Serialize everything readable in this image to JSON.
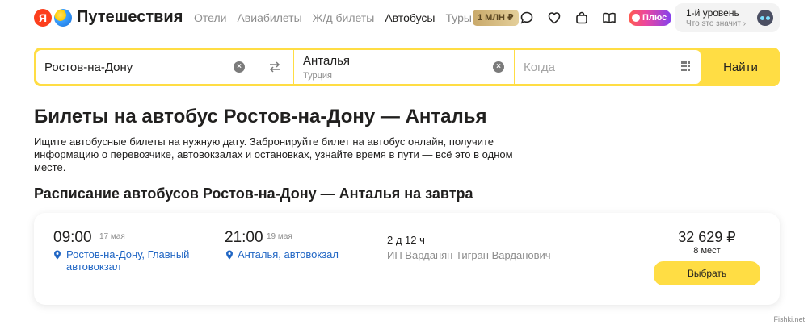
{
  "header": {
    "logo_letter": "Я",
    "logo_text": "Путешествия",
    "nav": [
      {
        "label": "Отели",
        "active": false
      },
      {
        "label": "Авиабилеты",
        "active": false
      },
      {
        "label": "Ж/д билеты",
        "active": false
      },
      {
        "label": "Автобусы",
        "active": true
      },
      {
        "label": "Туры",
        "active": false
      }
    ],
    "badge": "1 МЛН ₽",
    "plus_label": "Плюс",
    "level_title": "1-й уровень",
    "level_sub": "Что это значит",
    "level_arrow": "›"
  },
  "search": {
    "from_value": "Ростов-на-Дону",
    "to_value": "Анталья",
    "to_sub": "Турция",
    "when_placeholder": "Когда",
    "clear_glyph": "×",
    "swap_glyph": "⇄",
    "find_label": "Найти"
  },
  "page": {
    "title": "Билеты на автобус Ростов-на-Дону — Анталья",
    "description": "Ищите автобусные билеты на нужную дату. Забронируйте билет на автобус онлайн, получите информацию о перевозчике, автовокзалах и остановках, узнайте время в пути — всё это в одном месте.",
    "schedule_title": "Расписание автобусов Ростов-на-Дону — Анталья на завтра"
  },
  "ticket": {
    "dep_time": "09:00",
    "dep_date": "17 мая",
    "dep_place_1": "Ростов-на-Дону, Главный",
    "dep_place_2": "автовокзал",
    "arr_time": "21:00",
    "arr_date": "19 мая",
    "arr_place": "Анталья, автовокзал",
    "duration": "2 д 12 ч",
    "carrier": "ИП Варданян Тигран Варданович",
    "price": "32 629 ₽",
    "seats": "8 мест",
    "choose_label": "Выбрать"
  },
  "watermark": "Fishki.net",
  "colors": {
    "accent": "#ffdd44",
    "link": "#2066c4",
    "text": "#21201f",
    "muted": "#8d8d8d"
  },
  "icons": [
    "yandex-logo-icon",
    "globe-icon",
    "chat-icon",
    "heart-icon",
    "bag-icon",
    "book-icon",
    "plus-icon",
    "robot-avatar-icon",
    "clear-icon",
    "swap-icon",
    "calendar-icon",
    "location-pin-icon"
  ]
}
